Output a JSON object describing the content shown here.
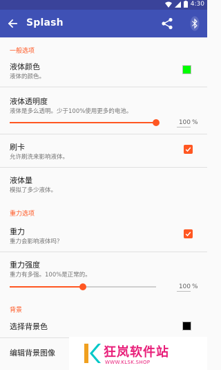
{
  "status_bar": {
    "time": "4:30"
  },
  "toolbar": {
    "title": "Splash"
  },
  "sections": {
    "general": "一般选项",
    "gravity": "重力选项",
    "background": "背景"
  },
  "settings": {
    "liquid_color": {
      "title": "液体颜色",
      "subtitle": "液体的颜色。",
      "color": "#00ff00"
    },
    "liquid_opacity": {
      "title": "液体透明度",
      "subtitle": "液体是多么透明。少于100%使用更多的电池。",
      "value": "100",
      "unit": "%",
      "level": 1.0
    },
    "swipe": {
      "title": "刷卡",
      "subtitle": "允许刷洗来影响液体。",
      "checked": true
    },
    "liquid_amount": {
      "title": "液体量",
      "subtitle": "模拟了多少液体。"
    },
    "gravity": {
      "title": "重力",
      "subtitle": "重力会影响液体吗？",
      "checked": true
    },
    "gravity_strength": {
      "title": "重力强度",
      "subtitle": "重力有多强。100%是正常的。",
      "value": "100",
      "unit": "%",
      "level": 0.5
    },
    "bg_color": {
      "title": "选择背景色",
      "color": "#000000"
    },
    "bg_image": {
      "title": "编辑背景图像"
    }
  },
  "watermark": {
    "brand": "狂岚软件站",
    "url": "WWW.KLSK.SHOP"
  },
  "colors": {
    "primary": "#3f51b5",
    "primary_dark": "#3a439a",
    "accent": "#ff5722",
    "watermark": "#e8207a"
  }
}
